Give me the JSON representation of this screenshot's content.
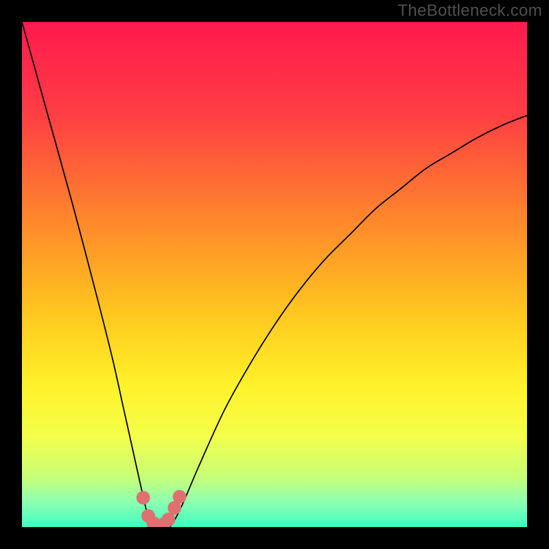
{
  "watermark": "TheBottleneck.com",
  "chart_data": {
    "type": "line",
    "title": "",
    "xlabel": "",
    "ylabel": "",
    "xlim": [
      0,
      100
    ],
    "ylim": [
      0,
      100
    ],
    "series": [
      {
        "name": "curve",
        "x": [
          0,
          5,
          10,
          15,
          18,
          20,
          22,
          24,
          25,
          26,
          27,
          28,
          29,
          30,
          32,
          35,
          40,
          45,
          50,
          55,
          60,
          65,
          70,
          75,
          80,
          85,
          90,
          95,
          100
        ],
        "y": [
          100,
          82,
          64,
          45,
          33,
          24,
          15,
          6,
          2,
          0,
          0,
          0,
          0,
          1,
          5,
          12,
          23,
          32,
          40,
          47,
          53,
          58,
          63,
          67,
          71,
          74,
          77,
          79.5,
          81.5
        ]
      }
    ],
    "markers": [
      {
        "x": 24.0,
        "y": 5.8
      },
      {
        "x": 25.0,
        "y": 2.2
      },
      {
        "x": 26.0,
        "y": 0.8
      },
      {
        "x": 27.0,
        "y": 0.3
      },
      {
        "x": 28.0,
        "y": 0.5
      },
      {
        "x": 29.0,
        "y": 1.5
      },
      {
        "x": 30.2,
        "y": 3.8
      },
      {
        "x": 31.2,
        "y": 6.0
      }
    ],
    "background_gradient": {
      "stops": [
        {
          "offset": 0.0,
          "color": "#ff1a4e"
        },
        {
          "offset": 0.18,
          "color": "#ff3d44"
        },
        {
          "offset": 0.4,
          "color": "#ff8a2a"
        },
        {
          "offset": 0.58,
          "color": "#ffc81e"
        },
        {
          "offset": 0.72,
          "color": "#fff22a"
        },
        {
          "offset": 0.82,
          "color": "#f3ff4a"
        },
        {
          "offset": 0.9,
          "color": "#c8ff76"
        },
        {
          "offset": 0.95,
          "color": "#8dffb0"
        },
        {
          "offset": 1.0,
          "color": "#3dffc0"
        }
      ]
    },
    "marker_color": "#e07070",
    "line_color": "#000000"
  }
}
